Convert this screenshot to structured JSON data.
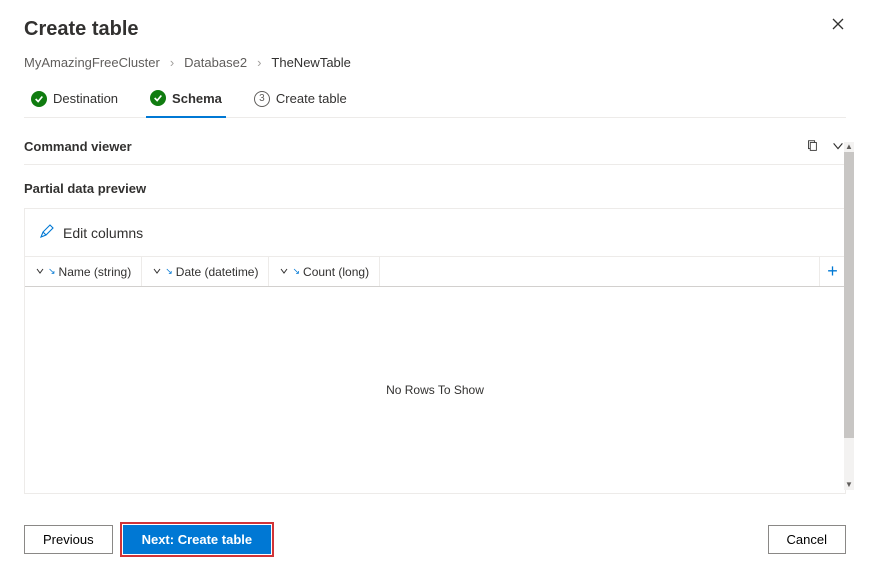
{
  "header": {
    "title": "Create table"
  },
  "breadcrumb": {
    "items": [
      "MyAmazingFreeCluster",
      "Database2",
      "TheNewTable"
    ]
  },
  "steps": [
    {
      "label": "Destination",
      "state": "done"
    },
    {
      "label": "Schema",
      "state": "done_active"
    },
    {
      "label": "Create table",
      "state": "pending",
      "num": "3"
    }
  ],
  "commandViewer": {
    "label": "Command viewer"
  },
  "preview": {
    "heading": "Partial data preview",
    "editColumns": "Edit columns",
    "columns": [
      {
        "name": "Name (string)"
      },
      {
        "name": "Date (datetime)"
      },
      {
        "name": "Count (long)"
      }
    ],
    "empty": "No Rows To Show"
  },
  "footer": {
    "previous": "Previous",
    "next": "Next: Create table",
    "cancel": "Cancel"
  }
}
